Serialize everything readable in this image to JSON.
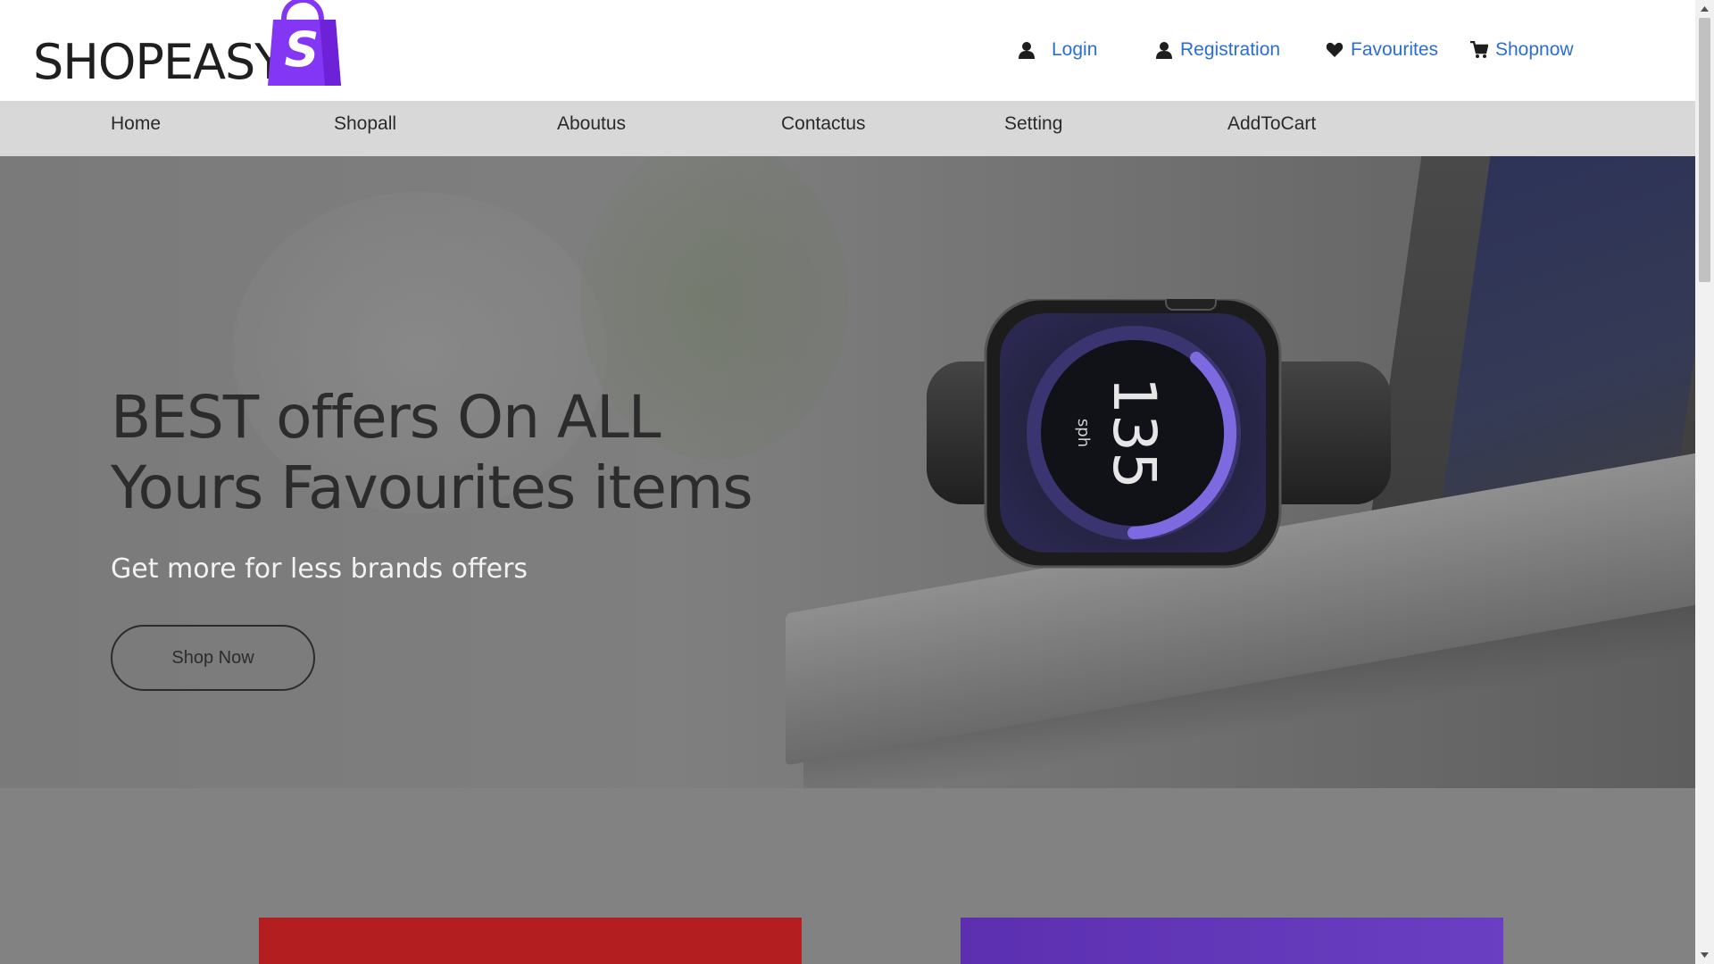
{
  "brand": {
    "name": "SHOPEASY",
    "logo_letter": "S",
    "logo_color": "#8436f5"
  },
  "header_links": [
    {
      "label": "Login",
      "icon": "user-icon"
    },
    {
      "label": "Registration",
      "icon": "user-icon"
    },
    {
      "label": "Favourites",
      "icon": "heart-icon"
    },
    {
      "label": "Shopnow",
      "icon": "cart-icon"
    }
  ],
  "nav": {
    "items": [
      "Home",
      "Shopall",
      "Aboutus",
      "Contactus",
      "Setting",
      "AddToCart"
    ]
  },
  "hero": {
    "heading_line1": "BEST offers On ALL",
    "heading_line2": "Yours Favourites items",
    "subheading": "Get more for less brands offers",
    "button_label": "Shop Now",
    "watch_reading": "135",
    "watch_unit": "sph"
  },
  "colors": {
    "link": "#2b6dd4",
    "card_red": "#b31f20",
    "card_purple": "#5b2fb0"
  }
}
